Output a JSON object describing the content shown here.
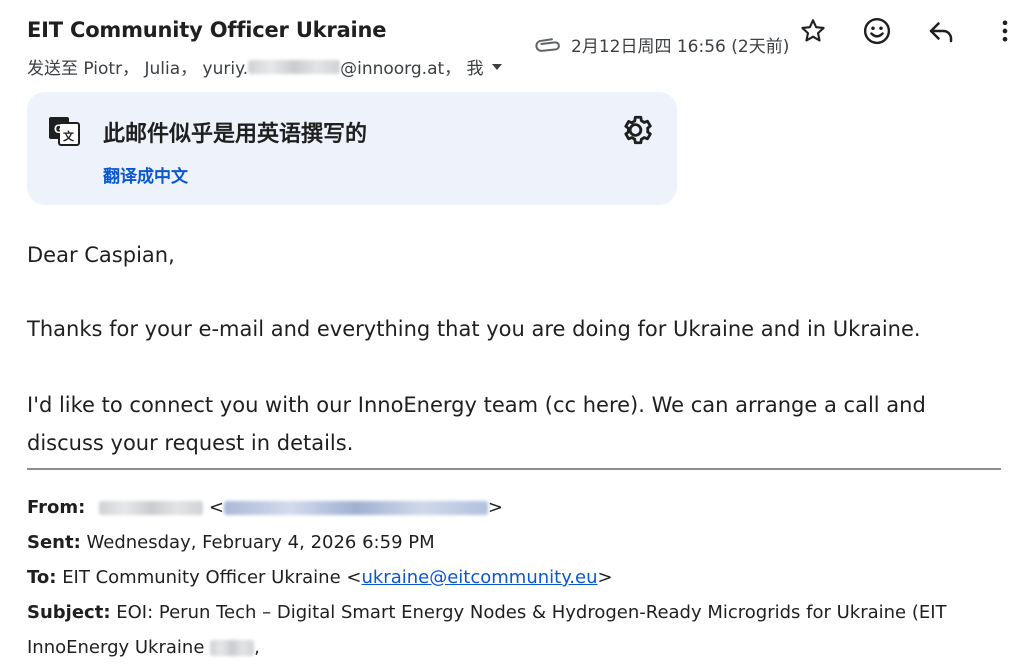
{
  "header": {
    "sender": "EIT Community Officer Ukraine",
    "recipients_prefix": "发送至 Piotr， Julia， yuriy.",
    "recipients_suffix": "@innoorg.at， 我",
    "date": "2月12日周四 16:56 (2天前)"
  },
  "actions": {
    "star": "star-icon",
    "emoji": "emoji-icon",
    "reply": "reply-icon",
    "more": "more-vert-icon"
  },
  "translate_card": {
    "title": "此邮件似乎是用英语撰写的",
    "link": "翻译成中文",
    "bg": "#edf2fb",
    "link_color": "#0b57d0"
  },
  "body": {
    "greeting": "Dear Caspian,",
    "para1": "Thanks for your e-mail and everything that you are doing for Ukraine and in Ukraine.",
    "para2": "I'd like to connect you with our InnoEnergy team (cc here). We can arrange a call and discuss your request in details."
  },
  "forwarded": {
    "from_label": "From:",
    "from_open": "<",
    "from_close": ">",
    "sent_label": "Sent:",
    "sent_value": "Wednesday, February 4, 2026 6:59 PM",
    "to_label": "To:",
    "to_name": "EIT Community Officer Ukraine <",
    "to_email": "ukraine@eitcommunity.eu",
    "to_close": ">",
    "subject_label": "Subject:",
    "subject_value": "EOI: Perun Tech – Digital Smart Energy Nodes & Hydrogen-Ready Microgrids for Ukraine (EIT InnoEnergy Ukraine",
    "subject_end": ","
  }
}
